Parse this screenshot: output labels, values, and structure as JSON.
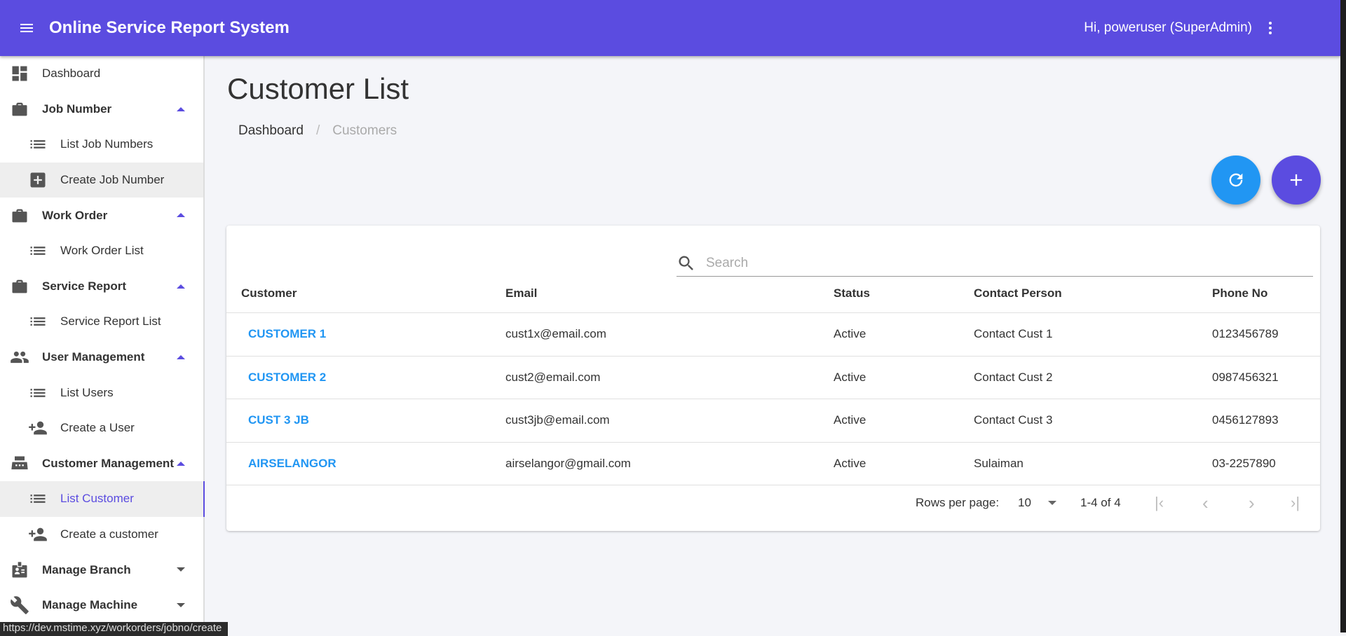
{
  "header": {
    "title": "Online Service Report System",
    "user": "Hi, poweruser (SuperAdmin)"
  },
  "sidebar": {
    "items": [
      {
        "label": "Dashboard",
        "icon": "dashboard-icon",
        "kind": "top plain"
      },
      {
        "label": "Job Number",
        "icon": "briefcase-icon",
        "kind": "top",
        "caret": "up"
      },
      {
        "label": "List Job Numbers",
        "icon": "list-icon",
        "kind": "sub"
      },
      {
        "label": "Create Job Number",
        "icon": "add-box-icon",
        "kind": "sub hover"
      },
      {
        "label": "Work Order",
        "icon": "briefcase-icon",
        "kind": "top",
        "caret": "up"
      },
      {
        "label": "Work Order List",
        "icon": "list-icon",
        "kind": "sub"
      },
      {
        "label": "Service Report",
        "icon": "briefcase-icon",
        "kind": "top",
        "caret": "up"
      },
      {
        "label": "Service Report List",
        "icon": "list-icon",
        "kind": "sub"
      },
      {
        "label": "User Management",
        "icon": "people-icon",
        "kind": "top",
        "caret": "up"
      },
      {
        "label": "List Users",
        "icon": "list-icon",
        "kind": "sub"
      },
      {
        "label": "Create a User",
        "icon": "person-add-icon",
        "kind": "sub"
      },
      {
        "label": "Customer Management",
        "icon": "fax-icon",
        "kind": "top",
        "caret": "up"
      },
      {
        "label": "List Customer",
        "icon": "list-icon",
        "kind": "sub active"
      },
      {
        "label": "Create a customer",
        "icon": "person-add-icon",
        "kind": "sub"
      },
      {
        "label": "Manage Branch",
        "icon": "badge-icon",
        "kind": "top",
        "caret": "down"
      },
      {
        "label": "Manage Machine",
        "icon": "wrench-icon",
        "kind": "top",
        "caret": "down"
      }
    ]
  },
  "status_url": "https://dev.mstime.xyz/workorders/jobno/create",
  "page": {
    "title": "Customer List",
    "breadcrumb": [
      "Dashboard",
      "Customers"
    ]
  },
  "colors": {
    "primary": "#5b4ce0",
    "refresh_fab": "#2196f3",
    "link": "#2196f3"
  },
  "table": {
    "search_placeholder": "Search",
    "columns": [
      "Customer",
      "Email",
      "Status",
      "Contact Person",
      "Phone No"
    ],
    "rows": [
      [
        "CUSTOMER 1",
        "cust1x@email.com",
        "Active",
        "Contact Cust 1",
        "0123456789"
      ],
      [
        "CUSTOMER 2",
        "cust2@email.com",
        "Active",
        "Contact Cust 2",
        "0987456321"
      ],
      [
        "CUST 3 JB",
        "cust3jb@email.com",
        "Active",
        "Contact Cust 3",
        "0456127893"
      ],
      [
        "AIRSELANGOR",
        "airselangor@gmail.com",
        "Active",
        "Sulaiman",
        "03-2257890"
      ]
    ],
    "rows_per_page_label": "Rows per page:",
    "rows_per_page": "10",
    "range": "1-4 of 4"
  }
}
